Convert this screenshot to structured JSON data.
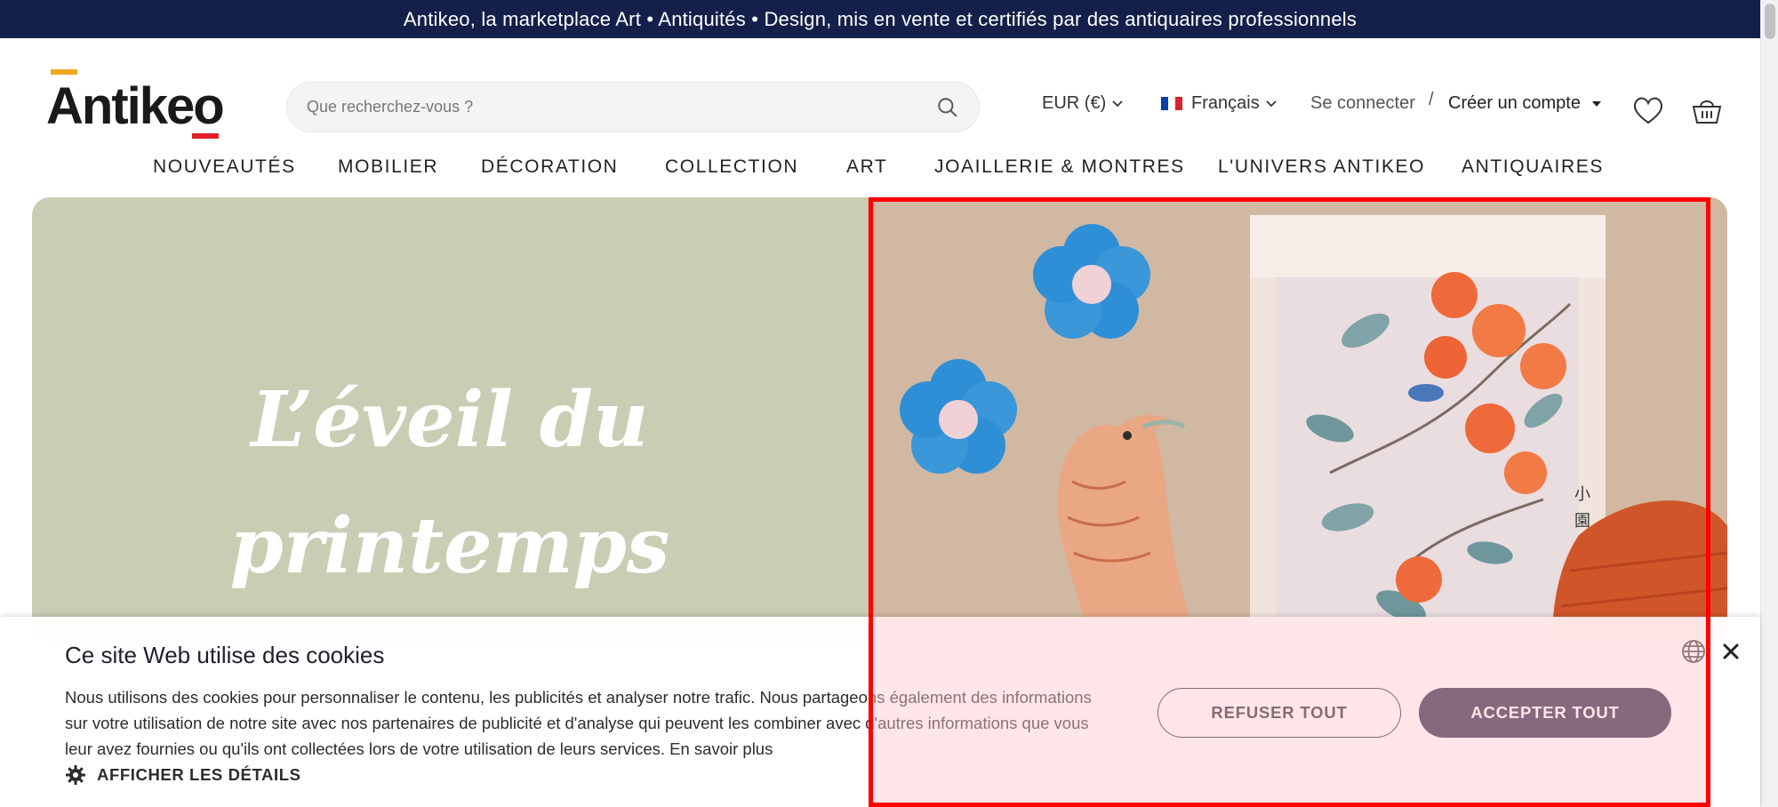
{
  "banner": {
    "text": "Antikeo, la marketplace Art • Antiquités • Design, mis en vente et certifiés par des antiquaires professionnels"
  },
  "header": {
    "logo_text": "Antikeo",
    "search_placeholder": "Que recherchez-vous ?",
    "currency": "EUR (€)",
    "language": "Français",
    "login": "Se connecter",
    "separator": "/",
    "register": "Créer un compte",
    "icons": {
      "search": "search-icon",
      "wishlist": "heart-icon",
      "cart": "basket-icon"
    }
  },
  "nav": {
    "items": [
      {
        "label": "NOUVEAUTÉS"
      },
      {
        "label": "MOBILIER"
      },
      {
        "label": "DÉCORATION"
      },
      {
        "label": "COLLECTION"
      },
      {
        "label": "ART"
      },
      {
        "label": "JOAILLERIE & MONTRES"
      },
      {
        "label": "L'UNIVERS ANTIKEO"
      },
      {
        "label": "ANTIQUAIRES"
      }
    ]
  },
  "hero": {
    "title_line1": "L’éveil du",
    "title_line2": "printemps",
    "bg_left": "#cacdb4",
    "bg_right": "#d1b8a2"
  },
  "cookie": {
    "title": "Ce site Web utilise des cookies",
    "text": "Nous utilisons des cookies pour personnaliser le contenu, les publicités et analyser notre trafic. Nous partageons également des informations sur votre utilisation de notre site avec nos partenaires de publicité et d'analyse qui peuvent les combiner avec d'autres informations que vous leur avez fournies ou qu'ils ont collectées lors de votre utilisation de leurs services.",
    "more_link": "En savoir plus",
    "details": "AFFICHER LES DÉTAILS",
    "refuse": "REFUSER TOUT",
    "accept": "ACCEPTER TOUT"
  },
  "colors": {
    "banner": "#14204a",
    "accept_button": "#231d3d",
    "highlight": "#ff0000",
    "logo_accent_top": "#f1a81f",
    "logo_accent_bottom": "#e0202b"
  }
}
